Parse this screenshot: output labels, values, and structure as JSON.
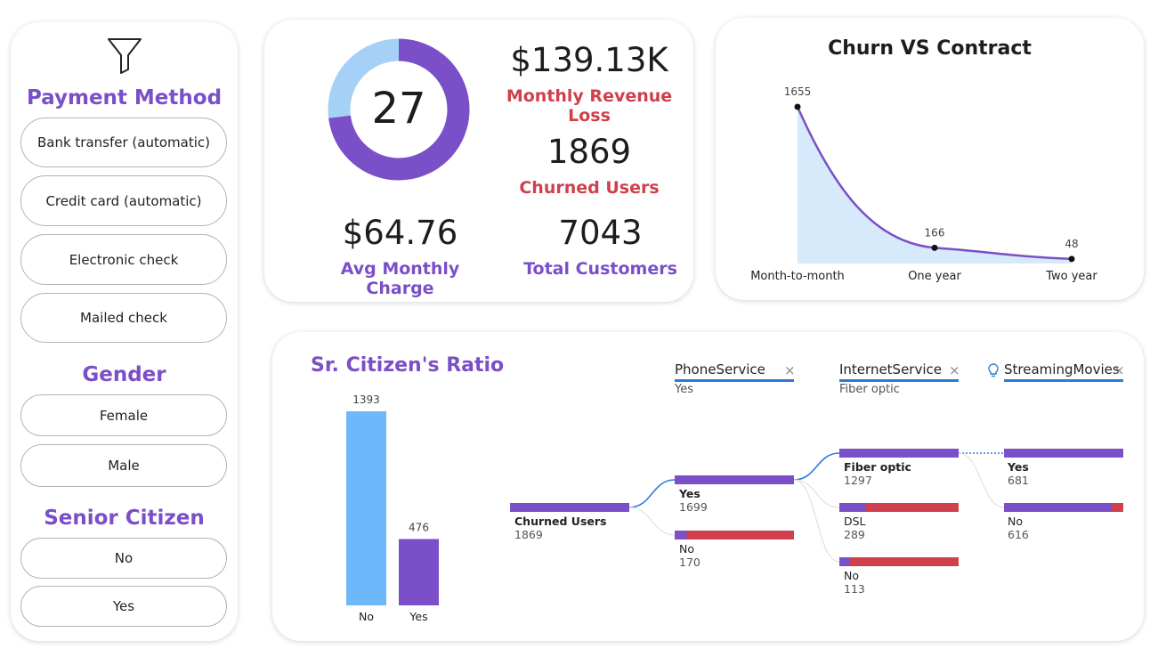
{
  "slicer": {
    "filter_icon": "filter-funnel-icon",
    "payment_heading": "Payment Method",
    "payment_options": [
      "Bank transfer (automatic)",
      "Credit card (automatic)",
      "Electronic check",
      "Mailed check"
    ],
    "gender_heading": "Gender",
    "gender_options": [
      "Female",
      "Male"
    ],
    "senior_heading": "Senior Citizen",
    "senior_options": [
      "No",
      "Yes"
    ]
  },
  "kpi": {
    "donut_value": "27",
    "donut_percent": 27,
    "revenue_loss_value": "$139.13K",
    "revenue_loss_label": "Monthly Revenue Loss",
    "churned_value": "1869",
    "churned_label": "Churned Users",
    "avg_charge_value": "$64.76",
    "avg_charge_label": "Avg Monthly Charge",
    "total_value": "7043",
    "total_label": "Total Customers"
  },
  "chart_data": [
    {
      "type": "area",
      "title": "Churn VS Contract",
      "categories": [
        "Month-to-month",
        "One year",
        "Two year"
      ],
      "values": [
        1655,
        166,
        48
      ],
      "data_labels": [
        "1655",
        "166",
        "48"
      ]
    },
    {
      "type": "bar",
      "title": "Sr. Citizen's Ratio",
      "categories": [
        "No",
        "Yes"
      ],
      "values": [
        1393,
        476
      ],
      "data_labels": [
        "1393",
        "476"
      ]
    }
  ],
  "decomposition_tree": {
    "levels": [
      {
        "field": "PhoneService",
        "selected": "Yes",
        "has_bulb": false
      },
      {
        "field": "InternetService",
        "selected": "Fiber optic",
        "has_bulb": false
      },
      {
        "field": "StreamingMovies",
        "selected": "",
        "has_bulb": true
      }
    ],
    "root": {
      "label": "Churned Users",
      "value": "1869"
    },
    "level1": [
      {
        "label": "Yes",
        "value": "1699",
        "fraction": 1.0
      },
      {
        "label": "No",
        "value": "170",
        "fraction": 0.1
      }
    ],
    "level2": [
      {
        "label": "Fiber optic",
        "value": "1297",
        "fraction": 1.0
      },
      {
        "label": "DSL",
        "value": "289",
        "fraction": 0.22
      },
      {
        "label": "No",
        "value": "113",
        "fraction": 0.09
      }
    ],
    "level3": [
      {
        "label": "Yes",
        "value": "681",
        "fraction": 1.0
      },
      {
        "label": "No",
        "value": "616",
        "fraction": 0.9
      }
    ]
  },
  "colors": {
    "purple": "#7a4fc7",
    "red": "#d0404c",
    "light_blue": "#a6d1f7",
    "bar_blue": "#6db8fb",
    "area_fill": "#d6eafb",
    "link_blue": "#2a7ad8"
  }
}
